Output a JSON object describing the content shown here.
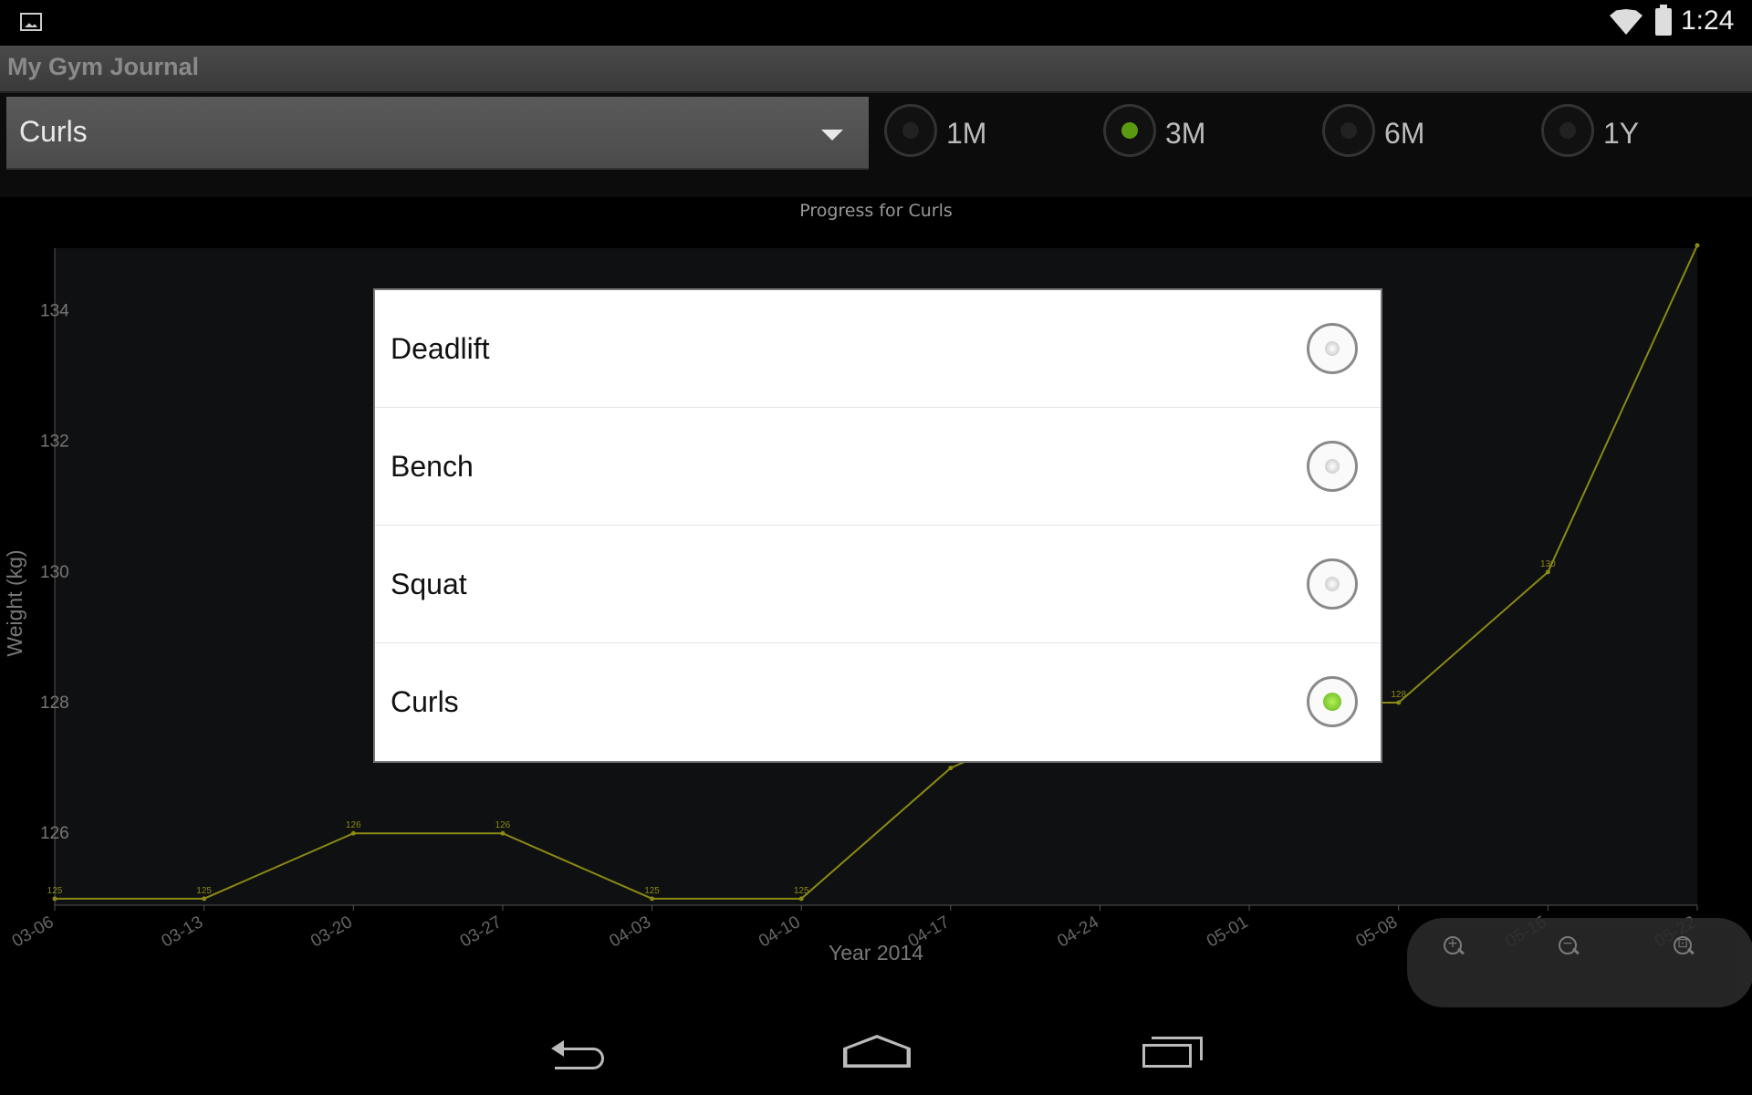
{
  "status_bar": {
    "time": "1:24",
    "icons": [
      "gallery-icon",
      "wifi-icon",
      "battery-icon"
    ]
  },
  "action_bar": {
    "title": "My Gym Journal"
  },
  "exercise_spinner": {
    "selected": "Curls"
  },
  "range_options": [
    {
      "label": "1M",
      "selected": false
    },
    {
      "label": "3M",
      "selected": true
    },
    {
      "label": "6M",
      "selected": false
    },
    {
      "label": "1Y",
      "selected": false
    }
  ],
  "chart_data": {
    "type": "line",
    "title": "Progress for Curls",
    "xlabel": "Year 2014",
    "ylabel": "Weight (kg)",
    "categories": [
      "03-06",
      "03-13",
      "03-20",
      "03-27",
      "04-03",
      "04-10",
      "04-17",
      "04-24",
      "05-01",
      "05-08",
      "05-15",
      "05-22"
    ],
    "yticks": [
      "134",
      "132",
      "130",
      "128",
      "126"
    ],
    "ylim": [
      124.9,
      134.9
    ],
    "series": [
      {
        "values": [
          125,
          125,
          126,
          126,
          125,
          125,
          127,
          128,
          128,
          128,
          130,
          135
        ],
        "point_labels": [
          "125",
          "125",
          "126",
          "126",
          "125",
          "125",
          "",
          "",
          "",
          "128",
          "130",
          ""
        ]
      }
    ],
    "line_color": "#8a8a14",
    "grid": false
  },
  "zoom_controls": [
    {
      "name": "zoom-in-icon",
      "sign": "+"
    },
    {
      "name": "zoom-out-icon",
      "sign": "−"
    },
    {
      "name": "zoom-reset-icon",
      "sign": "⊡"
    }
  ],
  "dialog": {
    "items": [
      {
        "label": "Deadlift",
        "selected": false
      },
      {
        "label": "Bench",
        "selected": false
      },
      {
        "label": "Squat",
        "selected": false
      },
      {
        "label": "Curls",
        "selected": true
      }
    ]
  },
  "nav_bar": {
    "buttons": [
      "back-icon",
      "home-icon",
      "recent-apps-icon"
    ]
  },
  "colors": {
    "accent": "#5cb518",
    "chart_bg": "#0f1012",
    "line": "#8a8a14"
  }
}
